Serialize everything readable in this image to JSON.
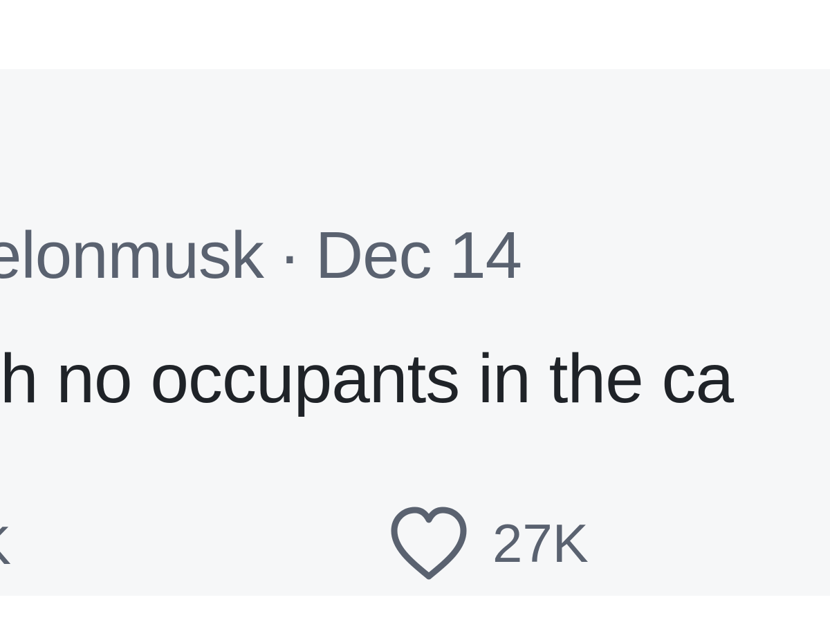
{
  "tweet": {
    "handle": "elonmusk",
    "separator": "·",
    "date": "Dec 14",
    "text": "h no occupants in the ca",
    "retweet_count": "K",
    "like_count": "27K"
  },
  "colors": {
    "card_background": "#f6f7f8",
    "text_primary": "#1f2328",
    "text_secondary": "#5a6270"
  },
  "icons": {
    "like": "heart-outline-icon"
  }
}
